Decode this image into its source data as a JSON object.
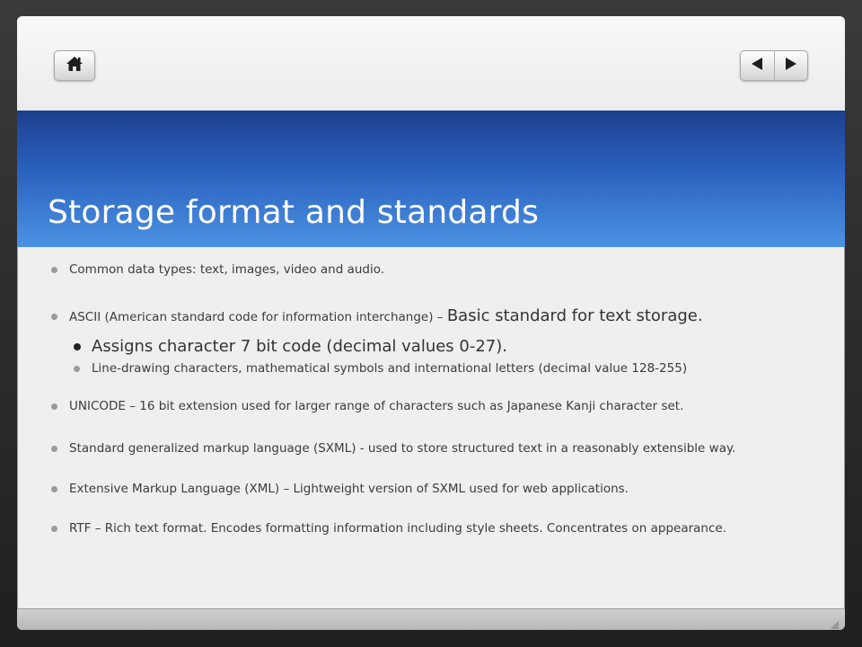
{
  "slide": {
    "title": "Storage format and standards",
    "bullets": {
      "b1": "Common data types: text, images, video and audio.",
      "b2_prefix": "ASCII (American standard code for information interchange) – ",
      "b2_big": "Basic standard for text storage.",
      "b2_1": "Assigns character 7 bit code (decimal values 0-27).",
      "b2_2": "Line-drawing characters, mathematical symbols and international letters (decimal value 128-255)",
      "b3": "UNICODE – 16 bit extension used for larger range of characters such as Japanese Kanji character set.",
      "b4": "Standard generalized markup language (SXML) -  used to store structured text in a reasonably extensible way.",
      "b5": "Extensive Markup Language (XML) – Lightweight version of SXML used for web applications.",
      "b6": "RTF – Rich text format. Encodes formatting information including style sheets.   Concentrates on appearance."
    }
  },
  "navigation": {
    "home_icon": "home-icon",
    "prev_icon": "triangle-left-icon",
    "next_icon": "triangle-right-icon"
  },
  "colors": {
    "title_band_top": "#1d3f8f",
    "title_band_bottom": "#4c93e3",
    "slide_background": "#efefef",
    "title_text": "#ffffff"
  }
}
